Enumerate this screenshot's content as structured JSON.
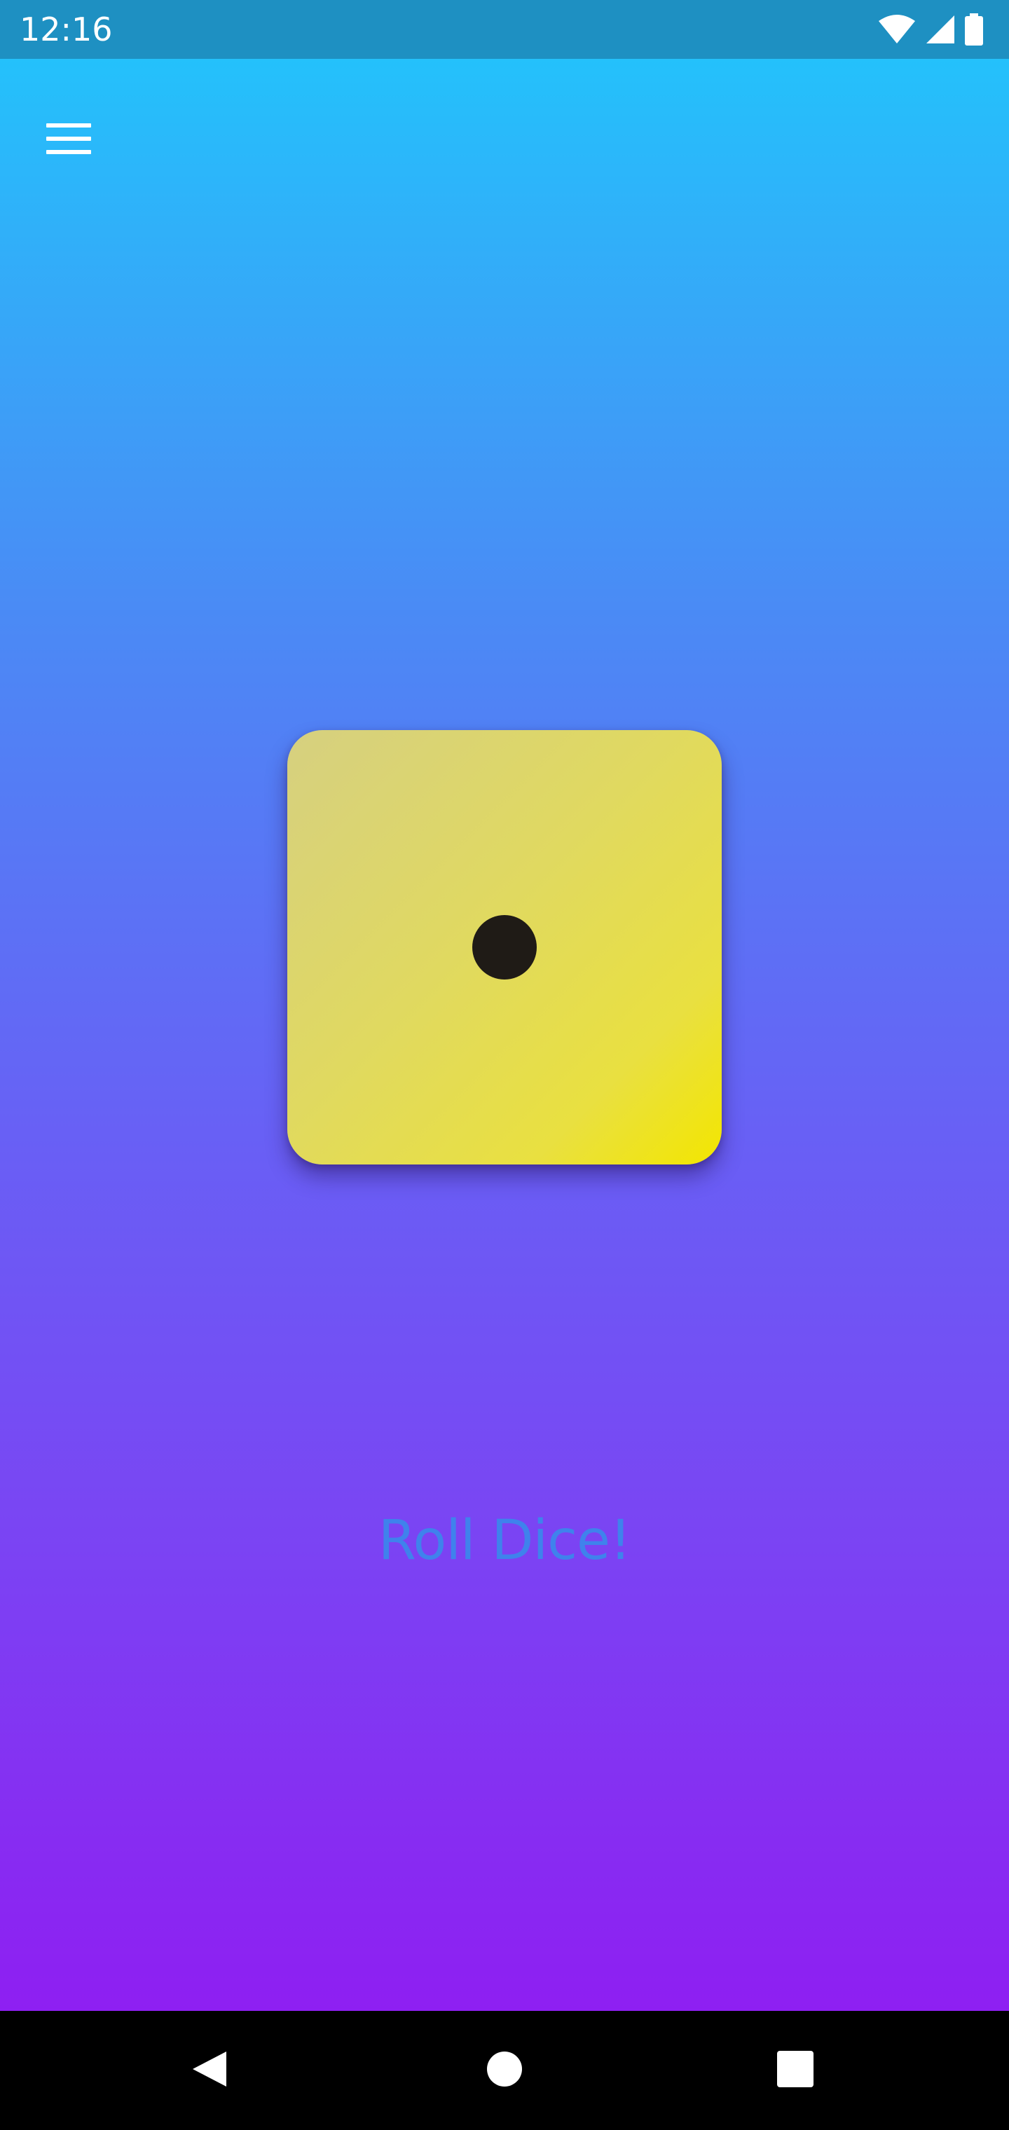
{
  "status_bar": {
    "time": "12:16",
    "icons": [
      "wifi-icon",
      "cell-signal-icon",
      "battery-icon"
    ],
    "background": "#1e90c2"
  },
  "app": {
    "menu_icon": "hamburger-menu-icon",
    "gradient_top": "#24c1fb",
    "gradient_bottom": "#8e1ff2",
    "die": {
      "face_value": 1,
      "color_start": "#d6d080",
      "color_end": "#f3e600",
      "pip_color": "#1f1b16"
    },
    "roll_button_label": "Roll Dice!",
    "roll_button_color": "#3f82ec"
  },
  "nav_bar": {
    "buttons": [
      "back-icon",
      "home-icon",
      "recents-icon"
    ]
  }
}
